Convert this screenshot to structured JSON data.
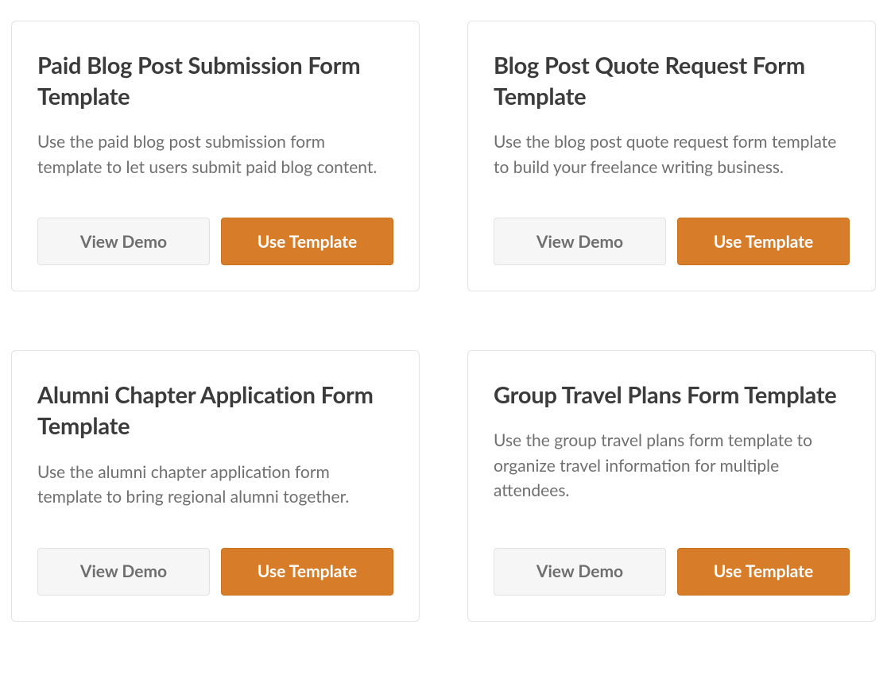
{
  "buttons": {
    "view_demo": "View Demo",
    "use_template": "Use Template"
  },
  "cards": [
    {
      "title": "Paid Blog Post Submission Form Template",
      "description": "Use the paid blog post submission form template to let users submit paid blog content."
    },
    {
      "title": "Blog Post Quote Request Form Template",
      "description": "Use the blog post quote request form template to build your freelance writing business."
    },
    {
      "title": "Alumni Chapter Application Form Template",
      "description": "Use the alumni chapter application form template to bring regional alumni together."
    },
    {
      "title": "Group Travel Plans Form Template",
      "description": "Use the group travel plans form template to organize travel information for multiple attendees."
    }
  ]
}
